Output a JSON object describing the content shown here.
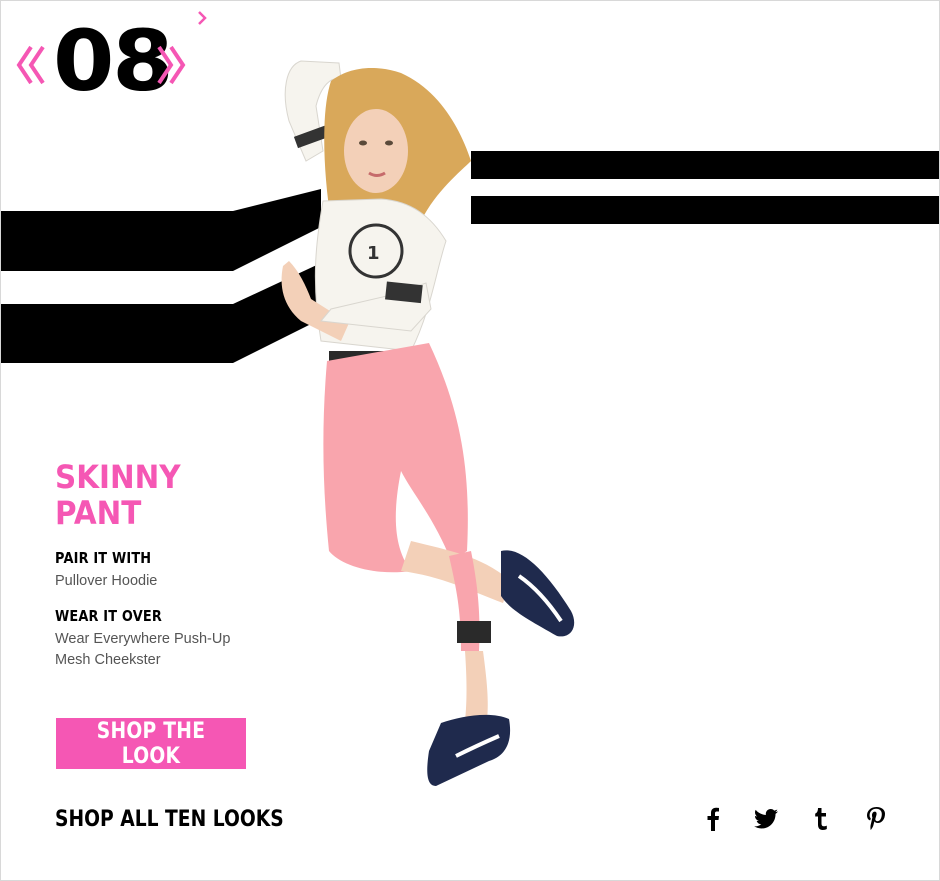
{
  "look": {
    "number": "08"
  },
  "product": {
    "title": "SKINNY PANT",
    "pair_label": "PAIR IT WITH",
    "pair_item": "Pullover Hoodie",
    "wear_label": "WEAR IT OVER",
    "wear_items": [
      "Wear Everywhere Push-Up",
      "Mesh Cheekster"
    ]
  },
  "actions": {
    "shop_look": "SHOP THE LOOK",
    "shop_all": "SHOP ALL TEN LOOKS"
  },
  "social": [
    {
      "name": "facebook-icon"
    },
    {
      "name": "twitter-icon"
    },
    {
      "name": "tumblr-icon"
    },
    {
      "name": "pinterest-icon"
    }
  ],
  "colors": {
    "brand_pink": "#f557b4",
    "pant_pink": "#f9a5ad",
    "stripe_black": "#000000",
    "sneaker_navy": "#1f2a4d"
  }
}
